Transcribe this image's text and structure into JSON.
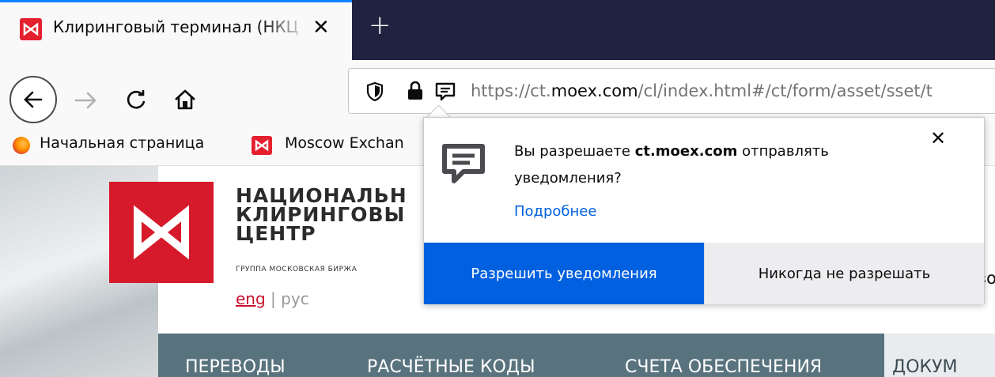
{
  "browser": {
    "tab": {
      "title": "Клиринговый терминал (НКЦ",
      "close_glyph": "✕"
    },
    "new_tab_glyph": "+",
    "url": {
      "prefix": "https://ct.",
      "domain": "moex.com",
      "suffix": "/cl/index.html#/ct/form/asset/sset/t"
    },
    "bookmarks": [
      {
        "label": "Начальная страница",
        "icon": "firefox-icon"
      },
      {
        "label": "Moscow Exchan",
        "icon": "moex-icon"
      }
    ]
  },
  "page": {
    "logo_lines": [
      "НАЦИОНАЛЬН",
      "КЛИРИНГОВЫ",
      "ЦЕНТР"
    ],
    "logo_subtitle": "ГРУППА МОСКОВСКАЯ БИРЖА",
    "lang": {
      "eng": "eng",
      "sep": "|",
      "rus": "рус"
    },
    "cut_char": "зо",
    "menu": [
      "ПЕРЕВОДЫ",
      "РАСЧЁТНЫЕ КОДЫ",
      "СЧЕТА ОБЕСПЕЧЕНИЯ",
      "ДОКУМ"
    ]
  },
  "notification_popup": {
    "message_prefix": "Вы разрешаете",
    "domain": "ct.moex.com",
    "message_suffix": "отправлять уведомления?",
    "learn_more": "Подробнее",
    "allow_button": "Разрешить уведомления",
    "deny_button": "Никогда не разрешать",
    "close_glyph": "✕"
  },
  "colors": {
    "tabstrip": "#202340",
    "accent": "#0a84ff",
    "allow_button": "#0060df",
    "moex_red": "#d71a2b",
    "menu_bg": "#59737e"
  }
}
